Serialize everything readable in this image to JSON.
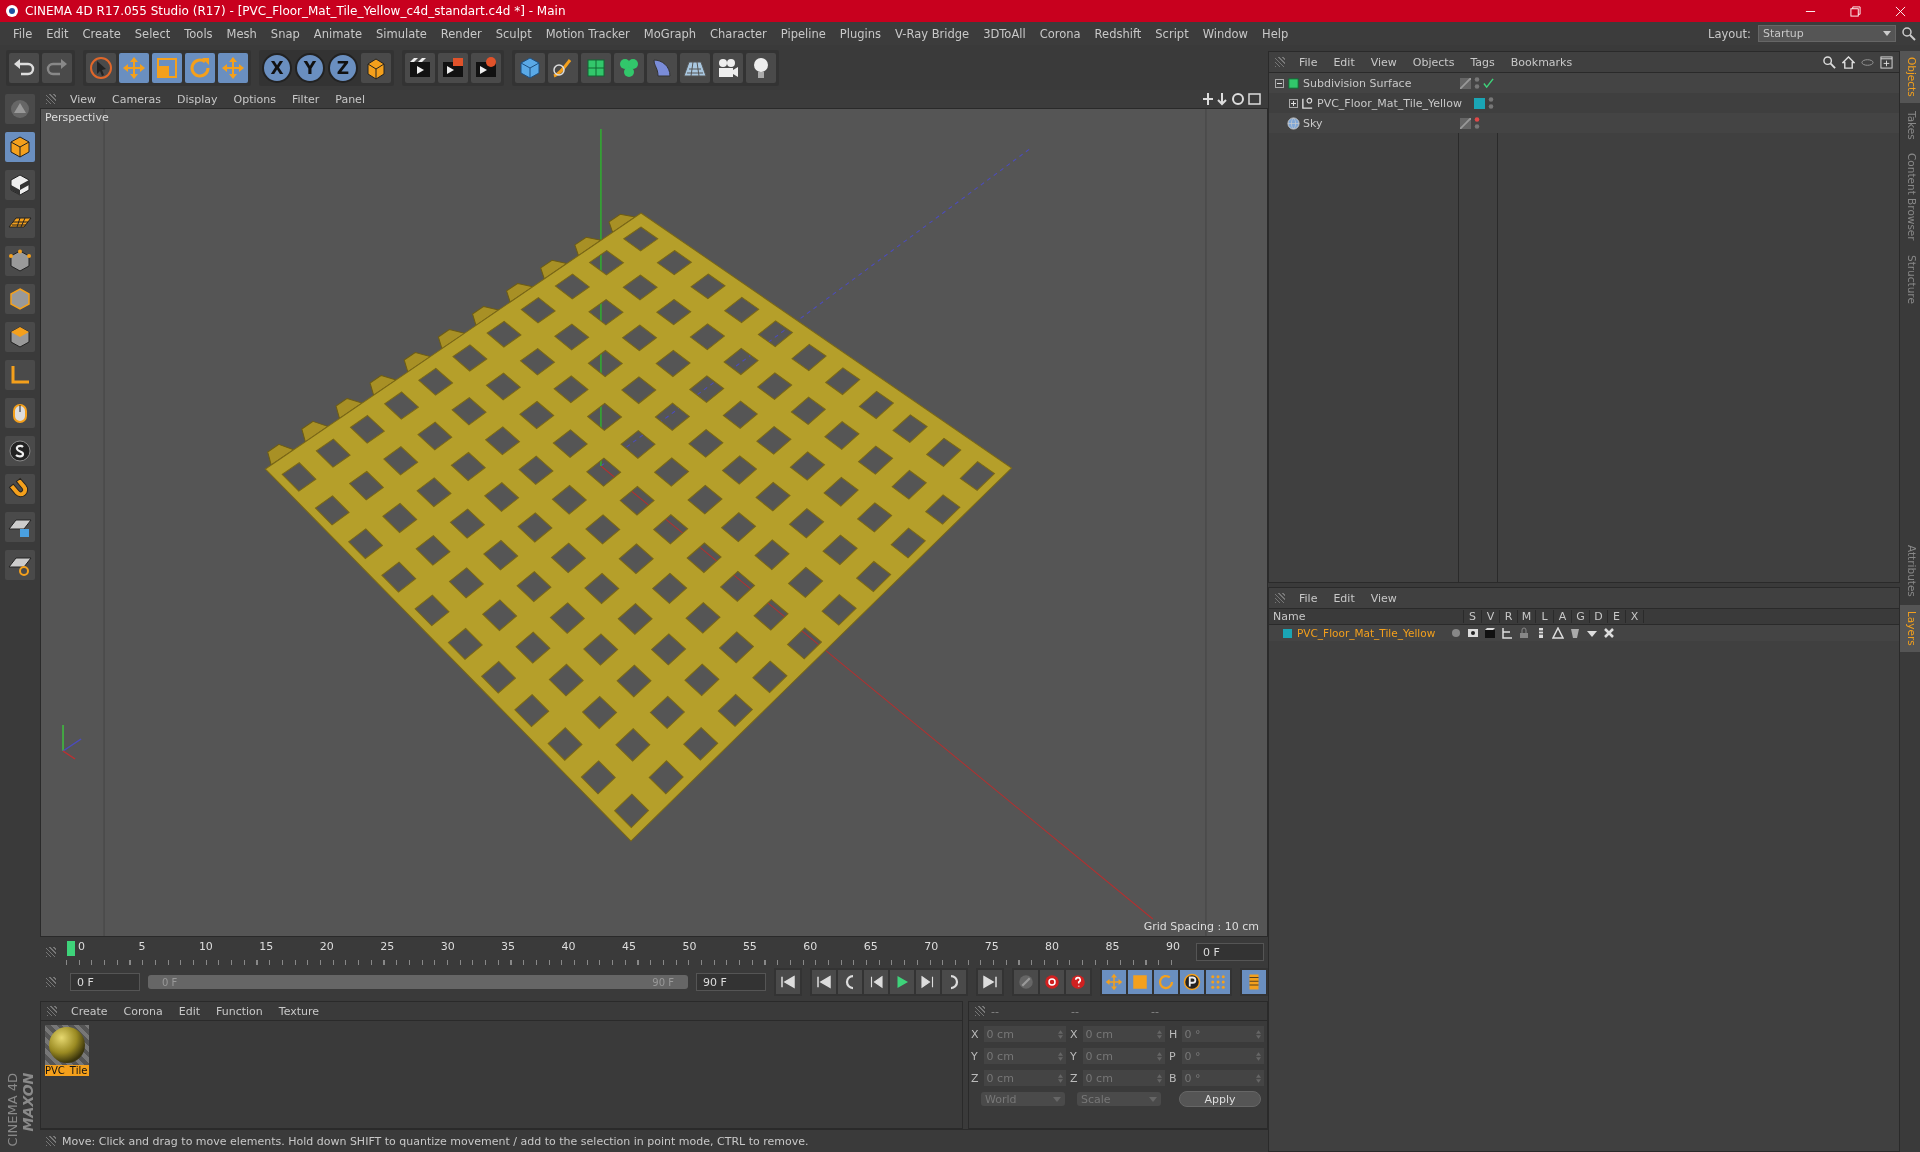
{
  "window": {
    "title": "CINEMA 4D R17.055 Studio (R17) - [PVC_Floor_Mat_Tile_Yellow_c4d_standart.c4d *] - Main"
  },
  "menu": [
    "File",
    "Edit",
    "Create",
    "Select",
    "Tools",
    "Mesh",
    "Snap",
    "Animate",
    "Simulate",
    "Render",
    "Sculpt",
    "Motion Tracker",
    "MoGraph",
    "Character",
    "Pipeline",
    "Plugins",
    "V-Ray Bridge",
    "3DToAll",
    "Corona",
    "Redshift",
    "Script",
    "Window",
    "Help"
  ],
  "layout": {
    "label": "Layout:",
    "value": "Startup"
  },
  "toolbar": {
    "axis_buttons": [
      "X",
      "Y",
      "Z"
    ]
  },
  "viewport": {
    "menu": [
      "View",
      "Cameras",
      "Display",
      "Options",
      "Filter",
      "Panel"
    ],
    "label": "Perspective",
    "grid_spacing": "Grid Spacing : 10 cm"
  },
  "timeline": {
    "ticks": [
      "0",
      "5",
      "10",
      "15",
      "20",
      "25",
      "30",
      "35",
      "40",
      "45",
      "50",
      "55",
      "60",
      "65",
      "70",
      "75",
      "80",
      "85",
      "90"
    ],
    "current": "0 F",
    "start": "0 F",
    "range_start": "0 F",
    "range_end": "90 F",
    "end": "90 F"
  },
  "material_manager": {
    "menu": [
      "Create",
      "Corona",
      "Edit",
      "Function",
      "Texture"
    ],
    "materials": [
      {
        "name": "PVC_Tile",
        "selected": true
      }
    ],
    "logo": [
      "MAXON",
      "CINEMA 4D"
    ]
  },
  "coordinates": {
    "headers": [
      "--",
      "--",
      "--"
    ],
    "rows": [
      {
        "labels": [
          "X",
          "X",
          "H"
        ],
        "values": [
          "0 cm",
          "0 cm",
          "0 °"
        ]
      },
      {
        "labels": [
          "Y",
          "Y",
          "P"
        ],
        "values": [
          "0 cm",
          "0 cm",
          "0 °"
        ]
      },
      {
        "labels": [
          "Z",
          "Z",
          "B"
        ],
        "values": [
          "0 cm",
          "0 cm",
          "0 °"
        ]
      }
    ],
    "dropdowns": [
      "World",
      "Scale"
    ],
    "apply": "Apply"
  },
  "status_bar": "Move: Click and drag to move elements. Hold down SHIFT to quantize movement / add to the selection in point mode, CTRL to remove.",
  "object_manager": {
    "menu": [
      "File",
      "Edit",
      "View",
      "Objects",
      "Tags",
      "Bookmarks"
    ],
    "objects": [
      {
        "name": "Subdivision Surface",
        "kind": "subdivision",
        "expanded": true,
        "enabled": true,
        "editor_visible": true,
        "children": [
          {
            "name": "PVC_Floor_Mat_Tile_Yellow",
            "kind": "null",
            "expanded": false,
            "enabled": false,
            "editor_visible": true,
            "color": "#1aa5b5"
          }
        ]
      },
      {
        "name": "Sky",
        "kind": "sky",
        "enabled": false,
        "editor_visible": false
      }
    ]
  },
  "layer_manager": {
    "menu": [
      "File",
      "Edit",
      "View"
    ],
    "columns": [
      "Name",
      "S",
      "V",
      "R",
      "M",
      "L",
      "A",
      "G",
      "D",
      "E",
      "X"
    ],
    "layers": [
      {
        "name": "PVC_Floor_Mat_Tile_Yellow",
        "color": "#1aa5b5"
      }
    ]
  },
  "side_tabs": {
    "top": [
      {
        "label": "Objects",
        "selected": true
      },
      {
        "label": "Takes",
        "selected": false
      },
      {
        "label": "Content Browser",
        "selected": false
      },
      {
        "label": "Structure",
        "selected": false
      }
    ],
    "bottom": [
      {
        "label": "Attributes",
        "selected": false
      },
      {
        "label": "Layers",
        "selected": true
      }
    ]
  }
}
